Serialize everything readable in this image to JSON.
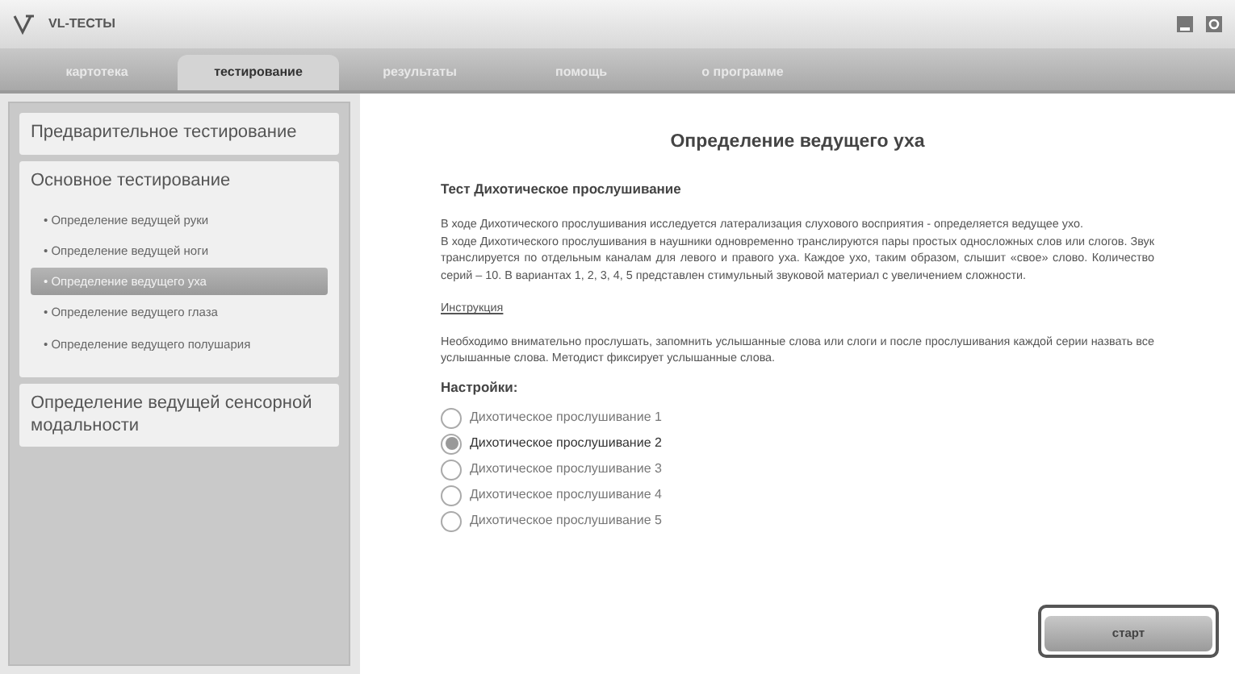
{
  "window": {
    "title": "VL-ТЕСТЫ"
  },
  "tabs": [
    {
      "label": "картотека",
      "selected": false
    },
    {
      "label": "тестирование",
      "selected": true
    },
    {
      "label": "результаты",
      "selected": false
    },
    {
      "label": "помощь",
      "selected": false
    },
    {
      "label": "о программе",
      "selected": false
    }
  ],
  "sidebar": {
    "sections": [
      {
        "title": "Предварительное тестирование"
      },
      {
        "title": "Основное тестирование",
        "items": [
          {
            "label": "• Определение ведущей руки",
            "selected": false
          },
          {
            "label": "• Определение ведущей ноги",
            "selected": false
          },
          {
            "label": "• Определение ведущего уха",
            "selected": true
          },
          {
            "label": "• Определение ведущего глаза",
            "selected": false
          },
          {
            "label": "• Определение ведущего полушария",
            "selected": false
          }
        ]
      },
      {
        "title": "Определение ведущей сенсорной модальности"
      }
    ]
  },
  "content": {
    "title": "Определение ведущего уха",
    "subtitle": "Тест Дихотическое прослушивание",
    "description": [
      "В ходе Дихотического прослушивания  исследуется латерализация слухового восприятия  - определяется ведущее ухо.",
      "В ходе Дихотического прослушивания в наушники одновременно транслируются пары простых односложных слов или слогов. Звук транслируется по отдельным каналам для левого и правого уха. Каждое ухо, таким образом, слышит «свое» слово. Количество серий – 10. В вариантах 1, 2, 3, 4, 5 представлен стимульный звуковой материал с увеличением сложности."
    ],
    "instruction_link": "Инструкция",
    "instruction": "Необходимо внимательно прослушать, запомнить услышанные слова или слоги и после прослушивания каждой серии назвать все услышанные слова. Методист фиксирует услышанные слова.",
    "settings_title": "Настройки:",
    "options": [
      {
        "label": "Дихотическое прослушивание 1",
        "selected": false
      },
      {
        "label": "Дихотическое прослушивание 2",
        "selected": true
      },
      {
        "label": "Дихотическое прослушивание 3",
        "selected": false
      },
      {
        "label": "Дихотическое прослушивание 4",
        "selected": false
      },
      {
        "label": "Дихотическое прослушивание 5",
        "selected": false
      }
    ],
    "start_button": "старт"
  }
}
